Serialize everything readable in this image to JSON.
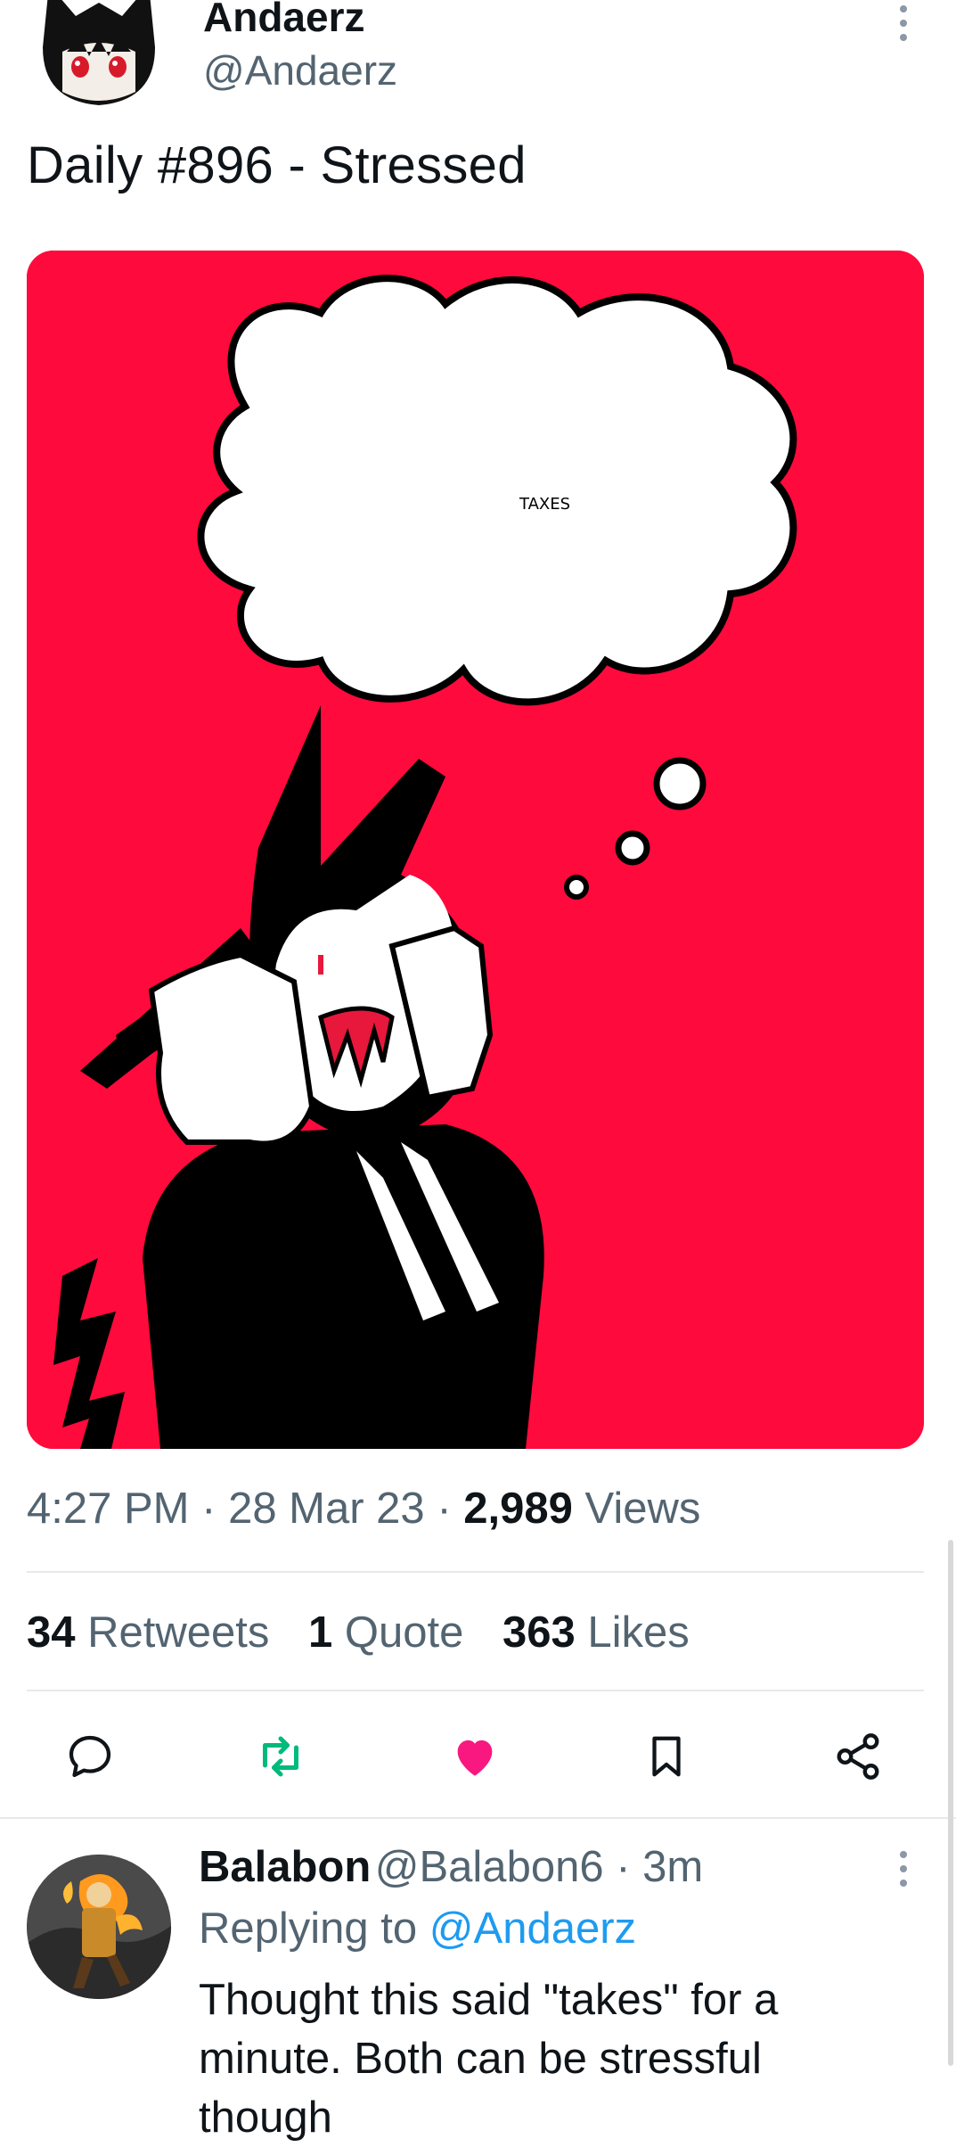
{
  "tweet": {
    "author_name": "Andaerz",
    "author_handle": "@Andaerz",
    "text": "Daily #896 - Stressed",
    "image_caption_text": "TAXES",
    "time": "4:27 PM",
    "date": "28 Mar 23",
    "separator": "·",
    "views_count": "2,989",
    "views_label": "Views",
    "retweets_count": "34",
    "retweets_label": "Retweets",
    "quotes_count": "1",
    "quotes_label": "Quote",
    "likes_count": "363",
    "likes_label": "Likes"
  },
  "actions": {
    "reply_icon": "reply-icon",
    "retweet_icon": "retweet-icon",
    "like_icon": "heart-filled-icon",
    "bookmark_icon": "bookmark-icon",
    "share_icon": "share-icon"
  },
  "reply": {
    "author_name": "Balabon",
    "author_handle": "@Balabon6",
    "time_ago": "3m",
    "replying_prefix": "Replying to",
    "replying_handle": "@Andaerz",
    "text": "Thought this said \"takes\" for a minute. Both can be stressful though"
  },
  "colors": {
    "accent_blue": "#1d9bf0",
    "retweet_green": "#00ba7c",
    "like_pink": "#f91880",
    "image_background": "#ff0a3c"
  }
}
